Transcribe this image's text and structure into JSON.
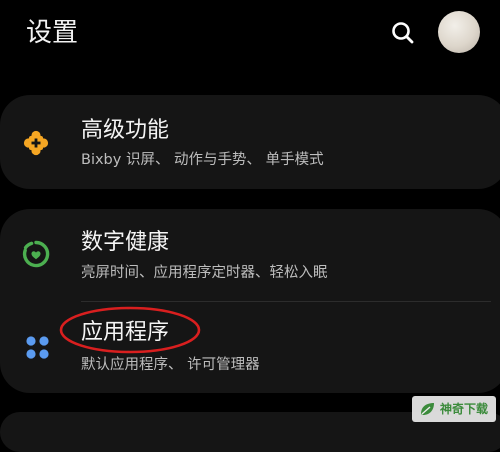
{
  "header": {
    "title": "设置",
    "search_icon": "search-icon",
    "avatar": "user-avatar"
  },
  "items": [
    {
      "title": "高级功能",
      "subtitle": "Bixby 识屏、 动作与手势、 单手模式",
      "icon": "puzzle-plus-icon",
      "icon_color": "#f5a623"
    },
    {
      "title": "数字健康",
      "subtitle": "亮屏时间、应用程序定时器、轻松入眠",
      "icon": "digital-wellbeing-icon",
      "icon_color": "#4caf50"
    },
    {
      "title": "应用程序",
      "subtitle": "默认应用程序、 许可管理器",
      "icon": "apps-dots-icon",
      "icon_color": "#5b9bf0"
    }
  ],
  "annotation": {
    "shape": "ellipse",
    "color": "#d91f1f",
    "target": "应用程序"
  },
  "watermark": {
    "text": "神奇下载",
    "color": "#3b8b3b"
  }
}
